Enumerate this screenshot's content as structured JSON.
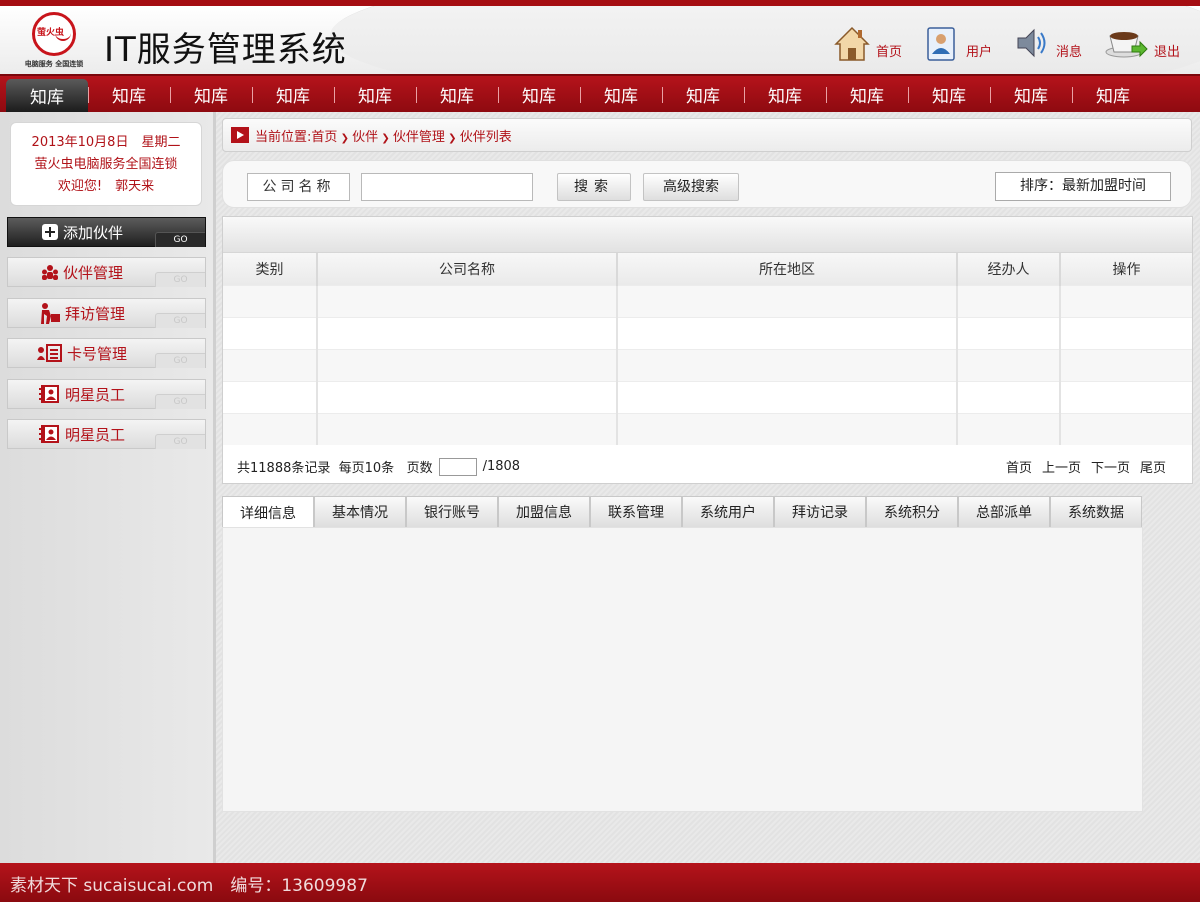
{
  "app": {
    "title": "IT服务管理系统",
    "logo_text": "萤火虫",
    "logo_sub": "电脑服务 全国连锁"
  },
  "toplinks": [
    {
      "label": "首页",
      "icon": "house-icon"
    },
    {
      "label": "用户",
      "icon": "user-card-icon"
    },
    {
      "label": "消息",
      "icon": "speaker-icon"
    },
    {
      "label": "退出",
      "icon": "coffee-exit-icon"
    }
  ],
  "nav": {
    "items": [
      "知库",
      "知库",
      "知库",
      "知库",
      "知库",
      "知库",
      "知库",
      "知库",
      "知库",
      "知库",
      "知库",
      "知库",
      "知库",
      "知库"
    ],
    "active_index": 0
  },
  "sidebar": {
    "date": "2013年10月8日　星期二",
    "company": "萤火虫电脑服务全国连锁",
    "welcome": "欢迎您!　郭天来",
    "buttons": [
      {
        "label": "添加伙伴",
        "icon": "plus-icon",
        "go": "GO"
      },
      {
        "label": "伙伴管理",
        "icon": "people-icon",
        "go": "GO"
      },
      {
        "label": "拜访管理",
        "icon": "visit-icon",
        "go": "GO"
      },
      {
        "label": "卡号管理",
        "icon": "card-icon",
        "go": "GO"
      },
      {
        "label": "明星员工",
        "icon": "contact-book-icon",
        "go": "GO"
      },
      {
        "label": "明星员工",
        "icon": "contact-book-icon",
        "go": "GO"
      }
    ]
  },
  "breadcrumb": {
    "prefix": "当前位置:",
    "items": [
      "首页",
      "伙伴",
      "伙伴管理",
      "伙伴列表"
    ]
  },
  "search": {
    "field_label": "公司名称",
    "value": "",
    "search_button": "搜索",
    "advanced_button": "高级搜索",
    "sort_label": "排序：最新加盟时间"
  },
  "grid": {
    "columns": [
      "类别",
      "公司名称",
      "所在地区",
      "经办人",
      "操作"
    ],
    "rows": 5
  },
  "pager": {
    "summary": "共11888条记录",
    "per_page": "每页10条",
    "page_label": "页数",
    "total_pages": "/1808",
    "links": [
      "首页",
      "上一页",
      "下一页",
      "尾页"
    ]
  },
  "tabs": [
    "详细信息",
    "基本情况",
    "银行账号",
    "加盟信息",
    "联系管理",
    "系统用户",
    "拜访记录",
    "系统积分",
    "总部派单",
    "系统数据"
  ],
  "footer": {
    "text": "素材天下 sucaisucai.com　编号：13609987"
  },
  "colors": {
    "brand_red": "#b3121a",
    "dark": "#1f1f1f"
  }
}
